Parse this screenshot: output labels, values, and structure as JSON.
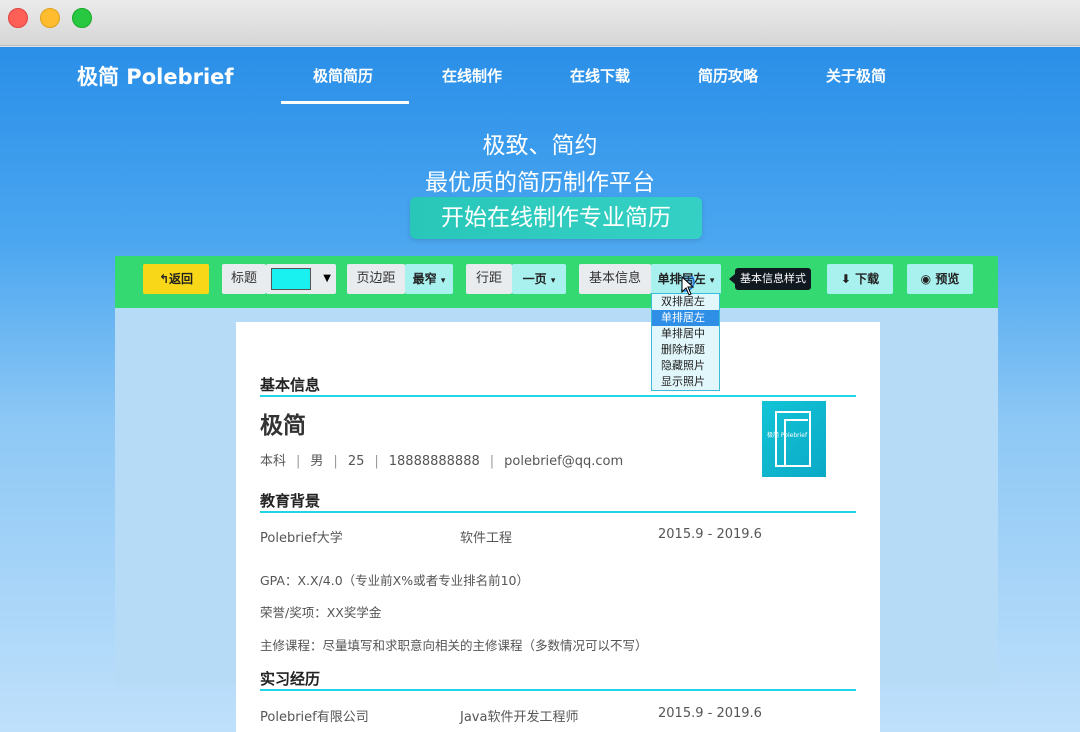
{
  "window": {
    "controls": [
      "close",
      "minimize",
      "maximize"
    ]
  },
  "header": {
    "brand": "极简 Polebrief",
    "nav": [
      "极简简历",
      "在线制作",
      "在线下载",
      "简历攻略",
      "关于极简"
    ],
    "active_nav": "极简简历"
  },
  "hero": {
    "line1": "极致、简约",
    "line2": "最优质的简历制作平台",
    "cta": "开始在线制作专业简历"
  },
  "toolbar": {
    "back": "返回",
    "title_label": "标题",
    "title_color": "#19f0f0",
    "margin_label": "页边距",
    "margin_value": "最窄",
    "spacing_label": "行距",
    "spacing_value": "一页",
    "basic_label": "基本信息",
    "basic_value": "单排居左",
    "tooltip": "基本信息样式",
    "download": "下载",
    "preview": "预览"
  },
  "dropdown": {
    "options": [
      "双排居左",
      "单排居左",
      "单排居中",
      "删除标题",
      "隐藏照片",
      "显示照片"
    ],
    "selected": "单排居左"
  },
  "resume": {
    "basic": {
      "title": "基本信息",
      "name": "极简",
      "degree": "本科",
      "gender": "男",
      "age": "25",
      "phone": "18888888888",
      "email": "polebrief@qq.com",
      "photo_text": "极简 Polebrief"
    },
    "education": {
      "title": "教育背景",
      "school": "Polebrief大学",
      "major": "软件工程",
      "period": "2015.9 - 2019.6",
      "gpa": "GPA：X.X/4.0（专业前X%或者专业排名前10）",
      "honors": "荣誉/奖项：XX奖学金",
      "courses": "主修课程：尽量填写和求职意向相关的主修课程（多数情况可以不写）"
    },
    "internship": {
      "title": "实习经历",
      "company": "Polebrief有限公司",
      "position": "Java软件开发工程师",
      "period": "2015.9 - 2019.6"
    }
  }
}
